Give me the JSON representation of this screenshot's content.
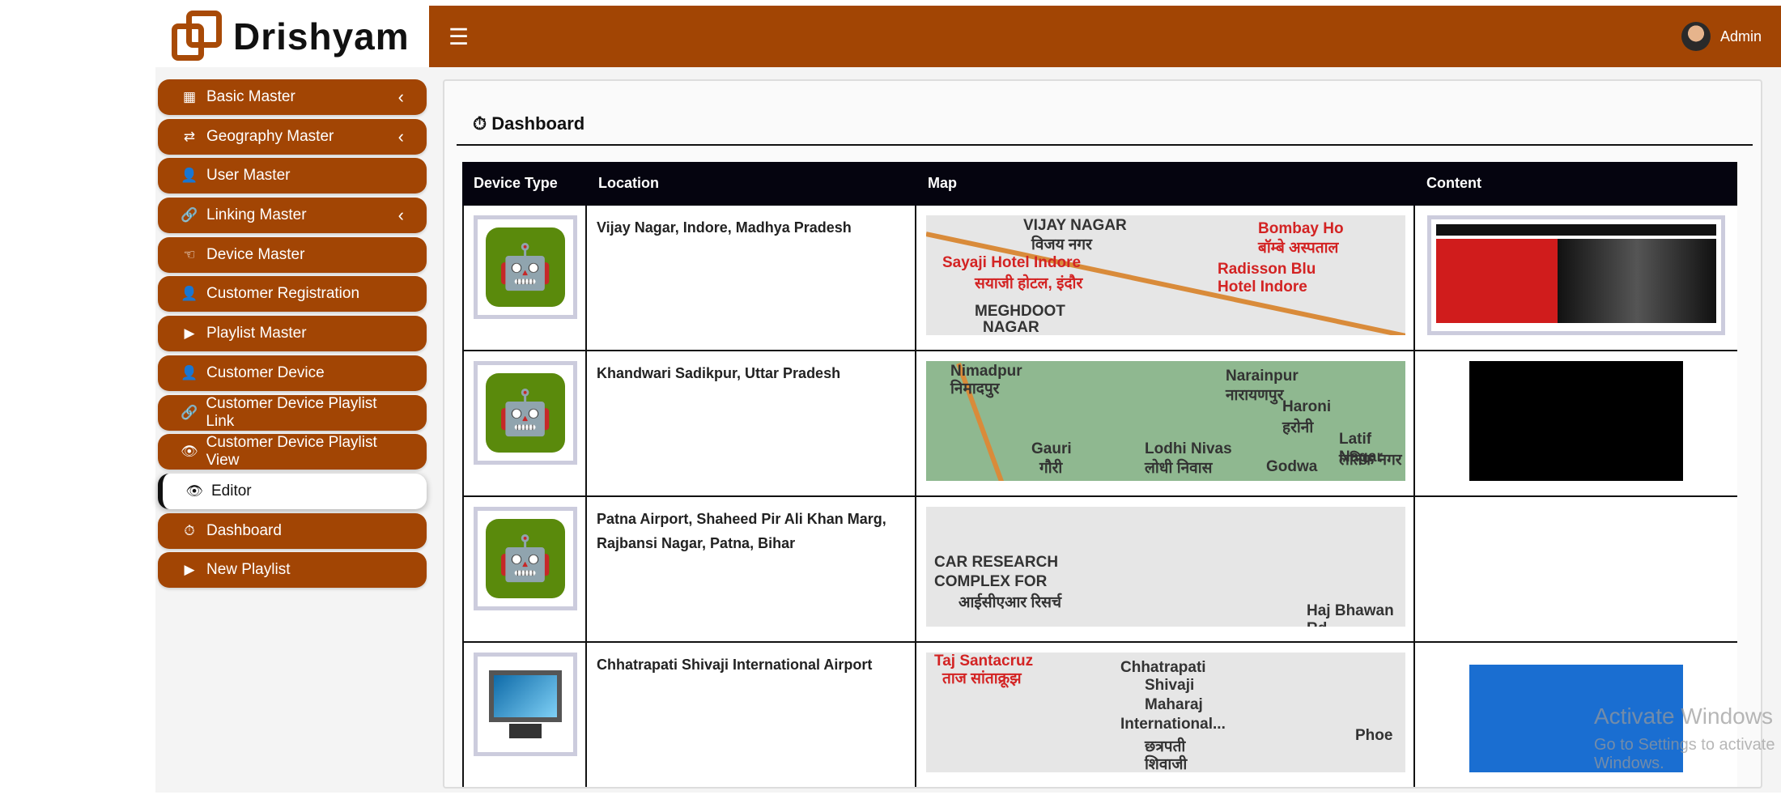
{
  "brand": {
    "name": "Drishyam"
  },
  "header": {
    "menu_icon": "hamburger-icon",
    "user": "Admin"
  },
  "sidebar": {
    "items": [
      {
        "label": "Basic Master",
        "icon": "grid-icon",
        "expandable": true
      },
      {
        "label": "Geography Master",
        "icon": "shuffle-icon",
        "expandable": true
      },
      {
        "label": "User Master",
        "icon": "user-icon"
      },
      {
        "label": "Linking Master",
        "icon": "link-icon",
        "expandable": true
      },
      {
        "label": "Device Master",
        "icon": "hand-point-icon"
      },
      {
        "label": "Customer Registration",
        "icon": "user-icon"
      },
      {
        "label": "Playlist Master",
        "icon": "play-icon"
      },
      {
        "label": "Customer Device",
        "icon": "user-icon"
      },
      {
        "label": "Customer Device Playlist Link",
        "icon": "link-icon"
      },
      {
        "label": "Customer Device Playlist View",
        "icon": "eye-icon"
      },
      {
        "label": "Editor",
        "icon": "eye-icon",
        "active": true
      },
      {
        "label": "Dashboard",
        "icon": "dashboard-icon"
      },
      {
        "label": "New Playlist",
        "icon": "play-icon"
      }
    ]
  },
  "main": {
    "title": "Dashboard",
    "columns": [
      "Device Type",
      "Location",
      "Map",
      "Content"
    ],
    "rows": [
      {
        "device": "android",
        "location": "Vijay Nagar, Indore, Madhya Pradesh",
        "map_labels": [
          "VIJAY NAGAR",
          "विजय नगर",
          "Bombay Ho",
          "बॉम्बे अस्पताल",
          "Sayaji Hotel Indore",
          "सयाजी होटल, इंदौर",
          "Radisson Blu",
          "Hotel Indore",
          "MEGHDOOT",
          "NAGAR"
        ],
        "content": "news"
      },
      {
        "device": "android",
        "location": "Khandwari Sadikpur, Uttar Pradesh",
        "map_labels": [
          "Nimadpur",
          "निमादपुर",
          "Narainpur",
          "नारायणपुर",
          "Haroni",
          "हरोनी",
          "Gauri",
          "गौरी",
          "Lodhi Nivas",
          "लोधी निवास",
          "Latif Nagar",
          "लतिफ नगर",
          "Godwa"
        ],
        "content": "black"
      },
      {
        "device": "android",
        "location": "Patna Airport, Shaheed Pir Ali Khan Marg, Rajbansi Nagar, Patna, Bihar",
        "map_labels": [
          "CAR RESEARCH",
          "COMPLEX FOR",
          "आईसीएआर रिसर्च",
          "Haj Bhawan Rd"
        ],
        "content": "none"
      },
      {
        "device": "monitor",
        "location": "Chhatrapati Shivaji International Airport",
        "map_labels": [
          "Taj Santacruz",
          "ताज सांताक्रूझ",
          "Chhatrapati",
          "Shivaji",
          "Maharaj",
          "International...",
          "छत्रपती",
          "शिवाजी",
          "Phoe"
        ],
        "content": "cartoon"
      }
    ]
  },
  "overlay": {
    "watermark_title": "Activate Windows",
    "watermark_sub": "Go to Settings to activate Windows."
  },
  "colors": {
    "brand": "#a24504",
    "table_header": "#05040f",
    "android": "#5a8a0c"
  }
}
